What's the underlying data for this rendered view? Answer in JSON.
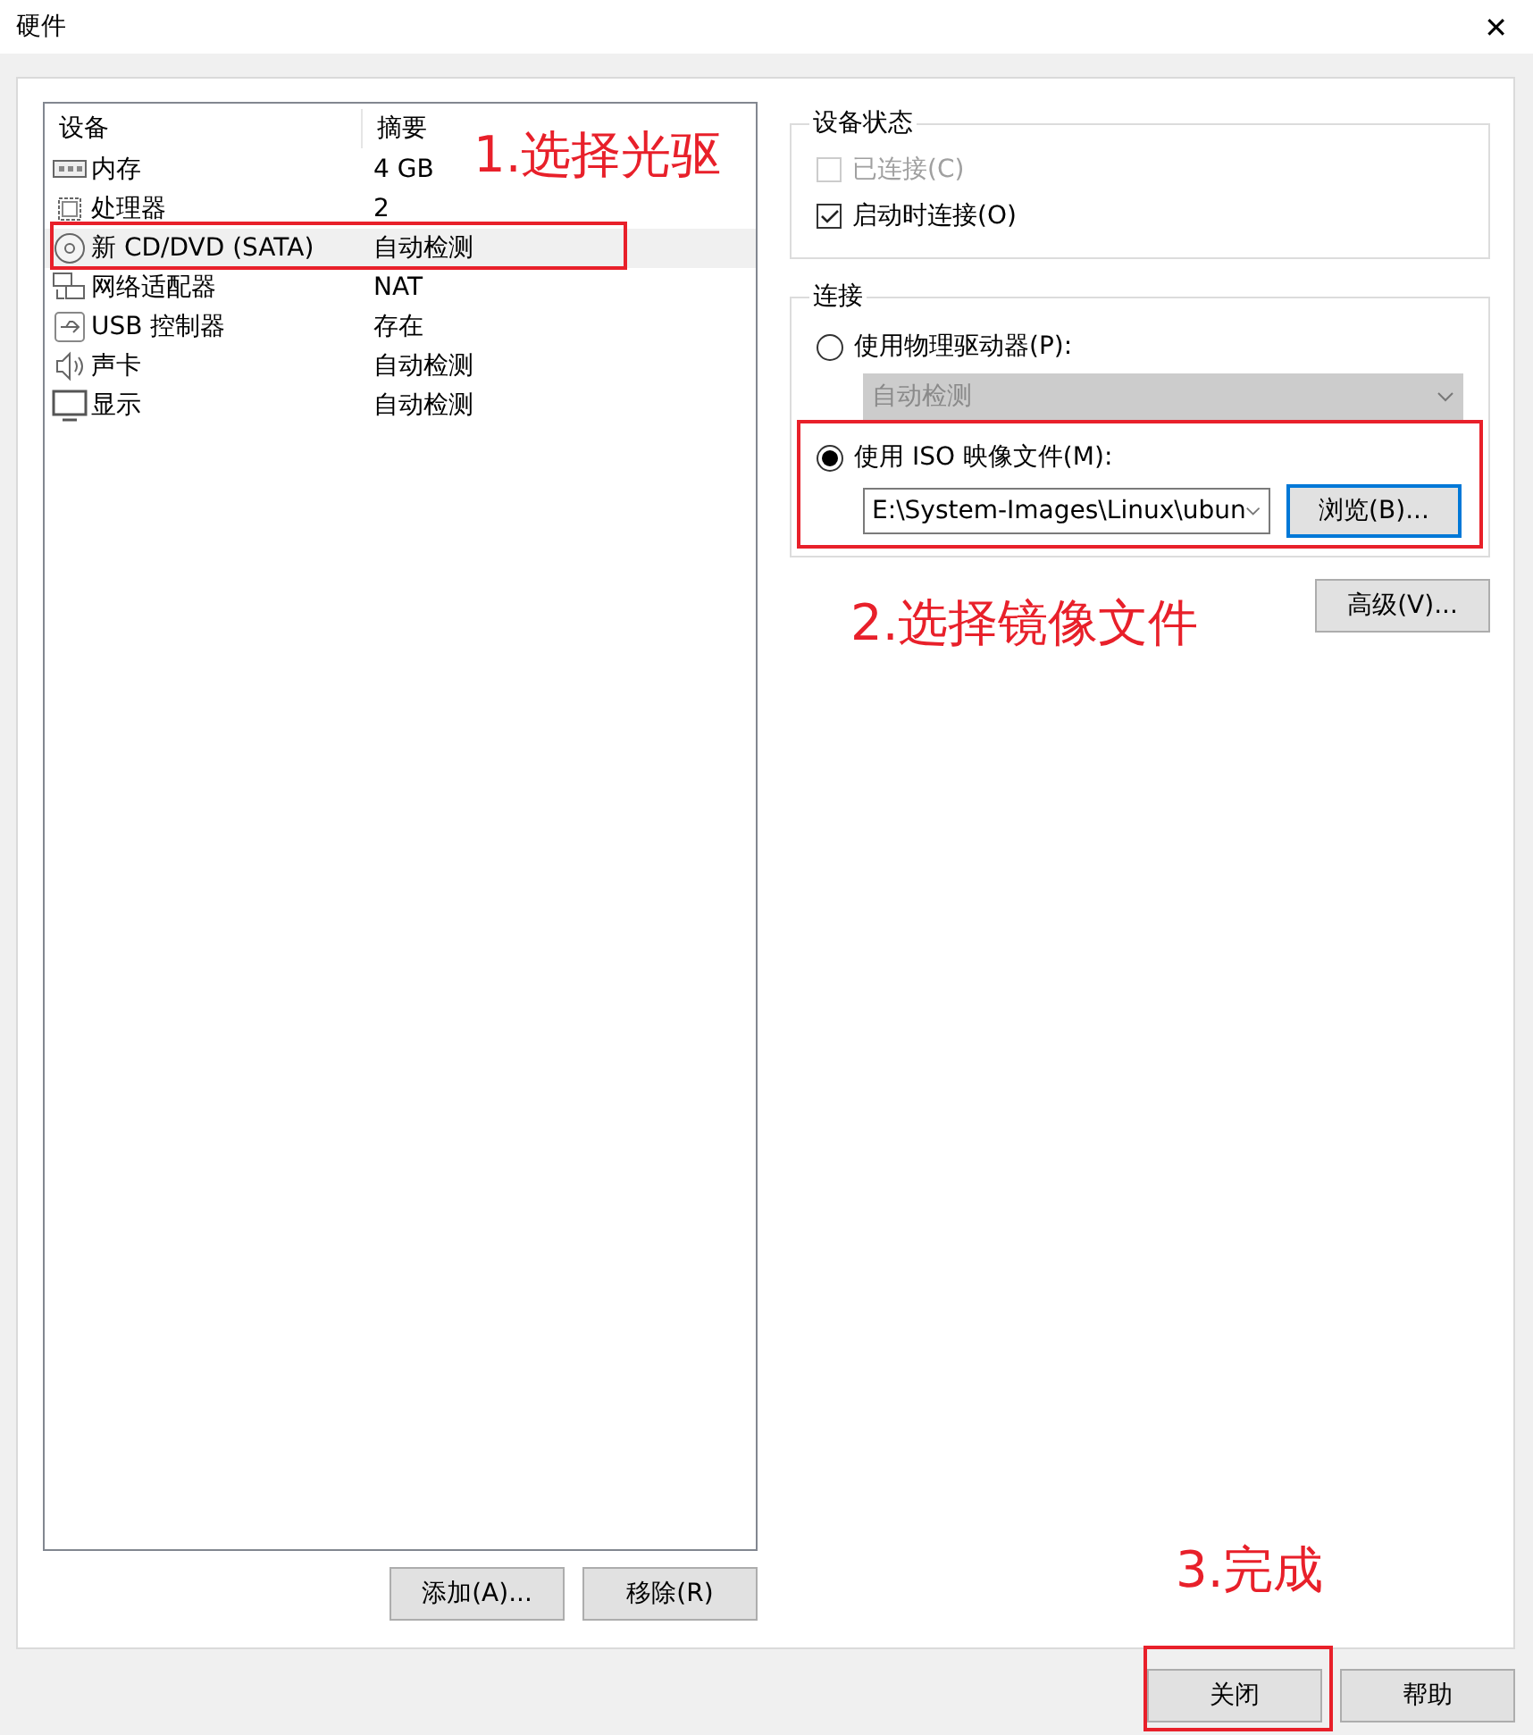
{
  "window": {
    "title": "硬件",
    "close": "✕"
  },
  "device_list": {
    "columns": [
      "设备",
      "摘要"
    ],
    "rows": [
      {
        "kind": "memory",
        "device": "内存",
        "summary": "4 GB",
        "selected": false,
        "highlighted": false
      },
      {
        "kind": "cpu",
        "device": "处理器",
        "summary": "2",
        "selected": false,
        "highlighted": false
      },
      {
        "kind": "cdrom",
        "device": "新 CD/DVD (SATA)",
        "summary": "自动检测",
        "selected": true,
        "highlighted": true
      },
      {
        "kind": "network",
        "device": "网络适配器",
        "summary": "NAT",
        "selected": false,
        "highlighted": false
      },
      {
        "kind": "usb",
        "device": "USB 控制器",
        "summary": "存在",
        "selected": false,
        "highlighted": false
      },
      {
        "kind": "sound",
        "device": "声卡",
        "summary": "自动检测",
        "selected": false,
        "highlighted": false
      },
      {
        "kind": "display",
        "device": "显示",
        "summary": "自动检测",
        "selected": false,
        "highlighted": false
      }
    ]
  },
  "list_buttons": [
    "添加(A)...",
    "移除(R)"
  ],
  "device_status": {
    "title": "设备状态",
    "options": [
      {
        "label": "已连接(C)",
        "checked": false,
        "disabled": true
      },
      {
        "label": "启动时连接(O)",
        "checked": true,
        "disabled": false
      }
    ]
  },
  "connection": {
    "title": "连接",
    "physical": {
      "label": "使用物理驱动器(P):",
      "selected": false,
      "drive": "自动检测",
      "disabled": true
    },
    "iso": {
      "label": "使用 ISO 映像文件(M):",
      "selected": true,
      "path": "E:\\System-Images\\Linux\\ubun",
      "browse": "浏览(B)...",
      "highlighted": true
    }
  },
  "advanced_button": "高级(V)...",
  "footer_buttons": [
    {
      "label": "关闭",
      "highlighted": true
    },
    {
      "label": "帮助",
      "highlighted": false
    }
  ],
  "annotations": [
    "1.选择光驱",
    "2.选择镜像文件",
    "3.完成"
  ]
}
